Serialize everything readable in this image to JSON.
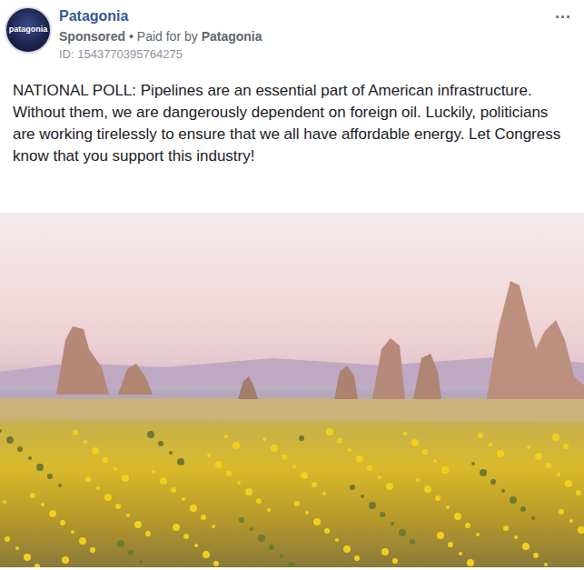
{
  "post": {
    "page_name": "Patagonia",
    "avatar_text": "patagonia",
    "sponsored": "Sponsored",
    "separator": "•",
    "paid_for_prefix": "Paid for by",
    "paid_for_name": "Patagonia",
    "ad_id": "ID: 1543770395764275",
    "menu": "...",
    "body": "NATIONAL POLL: Pipelines are an essential part of American infrastructure. Without them, we are dangerously dependent on foreign oil. Luckily, politicians are working tirelessly to ensure that we all have affordable energy. Let Congress know that you support this industry!"
  }
}
